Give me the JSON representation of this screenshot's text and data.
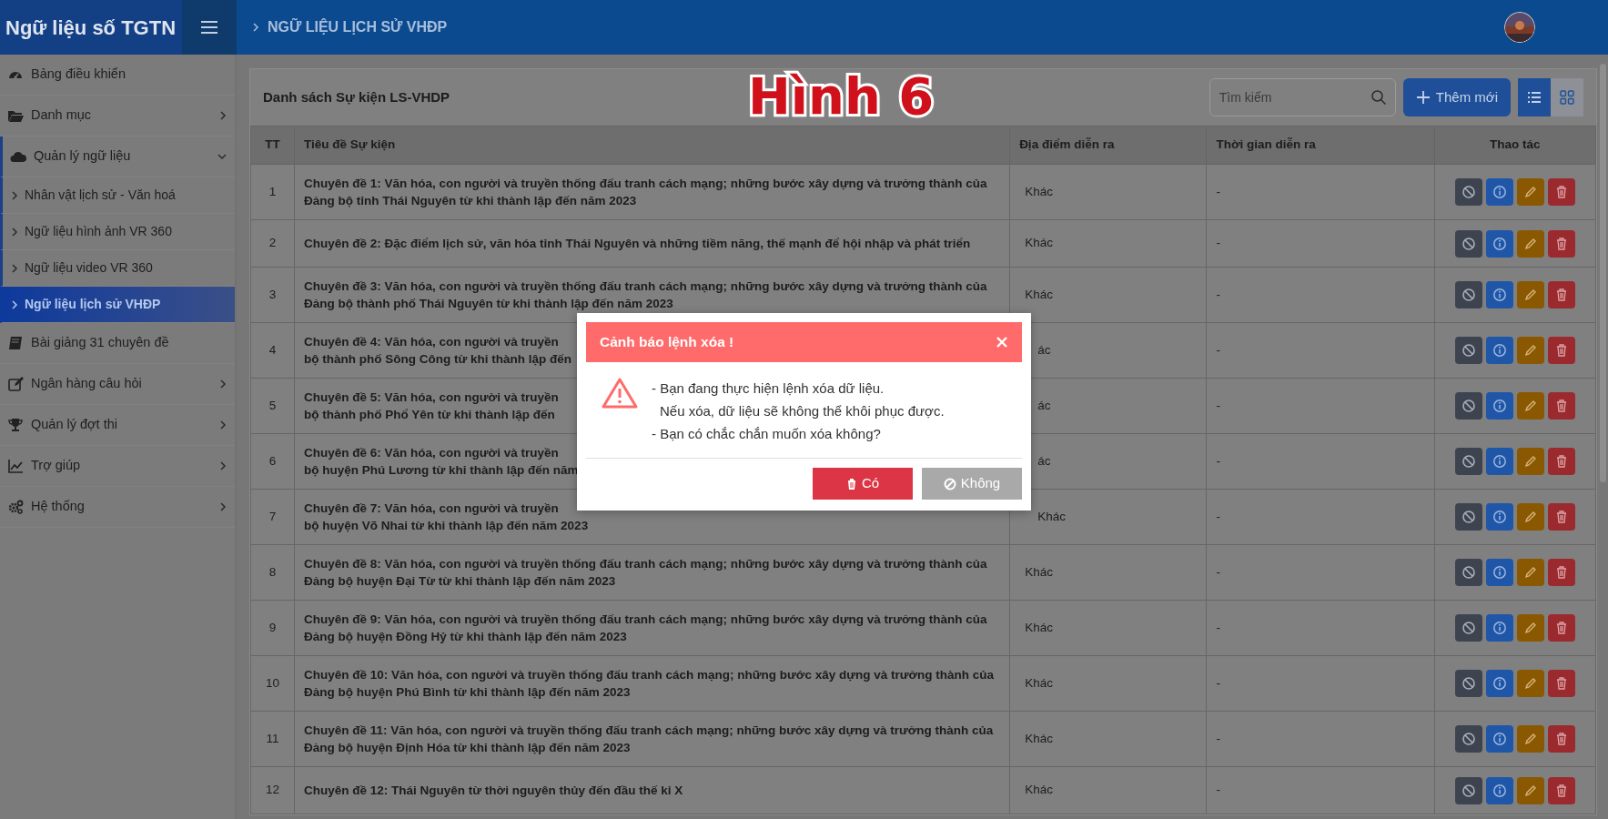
{
  "header": {
    "brand": "Ngữ liệu số TGTN",
    "breadcrumb": "NGỮ LIỆU LỊCH SỬ VHĐP"
  },
  "sidebar": {
    "items": [
      {
        "label": "Bảng điều khiển",
        "expandable": false,
        "expanded": false
      },
      {
        "label": "Danh mục",
        "expandable": true,
        "expanded": false
      },
      {
        "label": "Quản lý ngữ liệu",
        "expandable": true,
        "expanded": true,
        "children": [
          {
            "label": "Nhân vật lịch sử - Văn hoá",
            "selected": false
          },
          {
            "label": "Ngữ liệu hình ảnh VR 360",
            "selected": false
          },
          {
            "label": "Ngữ liệu video VR 360",
            "selected": false
          },
          {
            "label": "Ngữ liệu lịch sử VHĐP",
            "selected": true
          }
        ]
      },
      {
        "label": "Bài giảng 31 chuyên đề",
        "expandable": false,
        "expanded": false
      },
      {
        "label": "Ngân hàng câu hỏi",
        "expandable": true,
        "expanded": false
      },
      {
        "label": "Quản lý đợt thi",
        "expandable": true,
        "expanded": false
      },
      {
        "label": "Trợ giúp",
        "expandable": true,
        "expanded": false
      },
      {
        "label": "Hệ thống",
        "expandable": true,
        "expanded": false
      }
    ]
  },
  "figure_label": "Hình 6",
  "card": {
    "title": "Danh sách Sự kiện LS-VHDP",
    "search": {
      "placeholder": "Tìm kiếm"
    },
    "add_button": "Thêm mới",
    "views": [
      {
        "kind": "list",
        "selected": true
      },
      {
        "kind": "grid",
        "selected": false
      }
    ]
  },
  "table": {
    "columns": [
      "TT",
      "Tiêu đề Sự kiện",
      "Địa điểm diễn ra",
      "Thời gian diễn ra",
      "Thao tác"
    ],
    "rows": [
      {
        "kind": "full",
        "tt": "1",
        "title": "Chuyên đề 1: Văn hóa, con người và truyền thống đấu tranh cách mạng; những bước xây dựng và trưởng thành của Đảng bộ tỉnh Thái Nguyên từ khi thành lập đến năm 2023",
        "location": "Khác",
        "time": "-"
      },
      {
        "kind": "full",
        "tt": "2",
        "title": "Chuyên đề 2: Đặc điểm lịch sử, văn hóa tỉnh Thái Nguyên và những tiềm năng, thế mạnh để hội nhập và phát triển",
        "location": "Khác",
        "time": "-"
      },
      {
        "kind": "full",
        "tt": "3",
        "title": "Chuyên đề 3: Văn hóa, con người và truyền thống đấu tranh cách mạng; những bước xây dựng và trưởng thành của Đảng bộ thành phố Thái Nguyên từ khi thành lập đến năm 2023",
        "location": "Khác",
        "time": "-"
      },
      {
        "kind": "covered",
        "tt": "4",
        "title_lines": [
          "Chuyên đề 4: Văn hóa, con người và truyền",
          "bộ thành phố Sông Công từ khi thành lập đến"
        ],
        "location": "ác",
        "time": "-"
      },
      {
        "kind": "covered",
        "tt": "5",
        "title_lines": [
          "Chuyên đề 5: Văn hóa, con người và truyền",
          "bộ thành phố Phổ Yên từ khi thành lập đến"
        ],
        "location": "ác",
        "time": "-"
      },
      {
        "kind": "covered",
        "tt": "6",
        "title_lines": [
          "Chuyên đề 6: Văn hóa, con người và truyền",
          "bộ huyện Phú Lương từ khi thành lập đến năm"
        ],
        "location": "ác",
        "time": "-"
      },
      {
        "kind": "covered",
        "tt": "7",
        "title_lines": [
          "Chuyên đề 7: Văn hóa, con người và truyền",
          "bộ huyện Võ Nhai từ khi thành lập đến năm 2023"
        ],
        "location": "Khác",
        "time": "-"
      },
      {
        "kind": "full",
        "tt": "8",
        "title": "Chuyên đề 8: Văn hóa, con người và truyền thống đấu tranh cách mạng; những bước xây dựng và trưởng thành của Đảng bộ huyện Đại Từ từ khi thành lập đến năm 2023",
        "location": "Khác",
        "time": "-"
      },
      {
        "kind": "full",
        "tt": "9",
        "title": "Chuyên đề 9: Văn hóa, con người và truyền thống đấu tranh cách mạng; những bước xây dựng và trưởng thành của Đảng bộ huyện Đồng Hỷ từ khi thành lập đến năm 2023",
        "location": "Khác",
        "time": "-"
      },
      {
        "kind": "full",
        "tt": "10",
        "title": "Chuyên đề 10: Văn hóa, con người và truyền thống đấu tranh cách mạng; những bước xây dựng và trưởng thành của Đảng bộ huyện Phú Bình từ khi thành lập đến năm 2023",
        "location": "Khác",
        "time": "-"
      },
      {
        "kind": "full",
        "tt": "11",
        "title": "Chuyên đề 11: Văn hóa, con người và truyền thống đấu tranh cách mạng; những bước xây dựng và trưởng thành của Đảng bộ huyện Định Hóa từ khi thành lập đến năm 2023",
        "location": "Khác",
        "time": "-"
      },
      {
        "kind": "full",
        "tt": "12",
        "title": "Chuyên đề 12: Thái Nguyên từ thời nguyên thủy đến đầu thế kỉ X",
        "location": "Khác",
        "time": "-"
      }
    ]
  },
  "modal": {
    "title": "Cảnh báo lệnh xóa !",
    "lines": [
      {
        "kind": "item",
        "text": "- Bạn đang thực hiện lệnh xóa dữ liệu."
      },
      {
        "kind": "continuation",
        "text": "Nếu xóa, dữ liệu sẽ không thể khôi phục được."
      },
      {
        "kind": "item",
        "text": "- Bạn có chắc chắn muốn xóa không?"
      }
    ],
    "buttons": [
      {
        "kind": "confirm",
        "label": "Có"
      },
      {
        "kind": "cancel",
        "label": "Không"
      }
    ]
  }
}
